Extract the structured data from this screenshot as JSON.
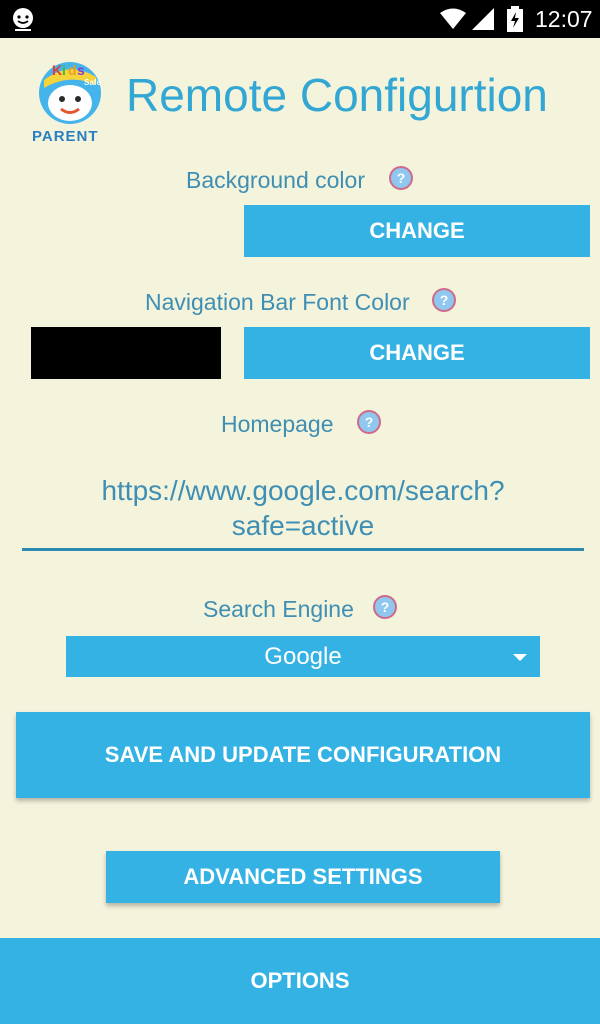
{
  "status_bar": {
    "time": "12:07",
    "icons": [
      "app-face-icon",
      "wifi-icon",
      "signal-icon",
      "battery-charging-icon"
    ]
  },
  "header": {
    "title": "Remote Configurtion",
    "logo": {
      "top_text": "Kids",
      "side_text": "Safe",
      "bottom_text": "PARENT"
    }
  },
  "background_color": {
    "label": "Background color",
    "button_label": "CHANGE"
  },
  "nav_bar_font_color": {
    "label": "Navigation Bar Font Color",
    "button_label": "CHANGE",
    "swatch_color": "#000000"
  },
  "homepage": {
    "label": "Homepage",
    "value_line1": "https://www.google.com/search?",
    "value_line2": "safe=active"
  },
  "search_engine": {
    "label": "Search Engine",
    "selected": "Google"
  },
  "actions": {
    "save": "SAVE AND UPDATE CONFIGURATION",
    "advanced": "ADVANCED SETTINGS",
    "options": "OPTIONS"
  },
  "colors": {
    "accent": "#34b2e4",
    "background": "#f4f3dc",
    "label_text": "#3e8fb3"
  }
}
